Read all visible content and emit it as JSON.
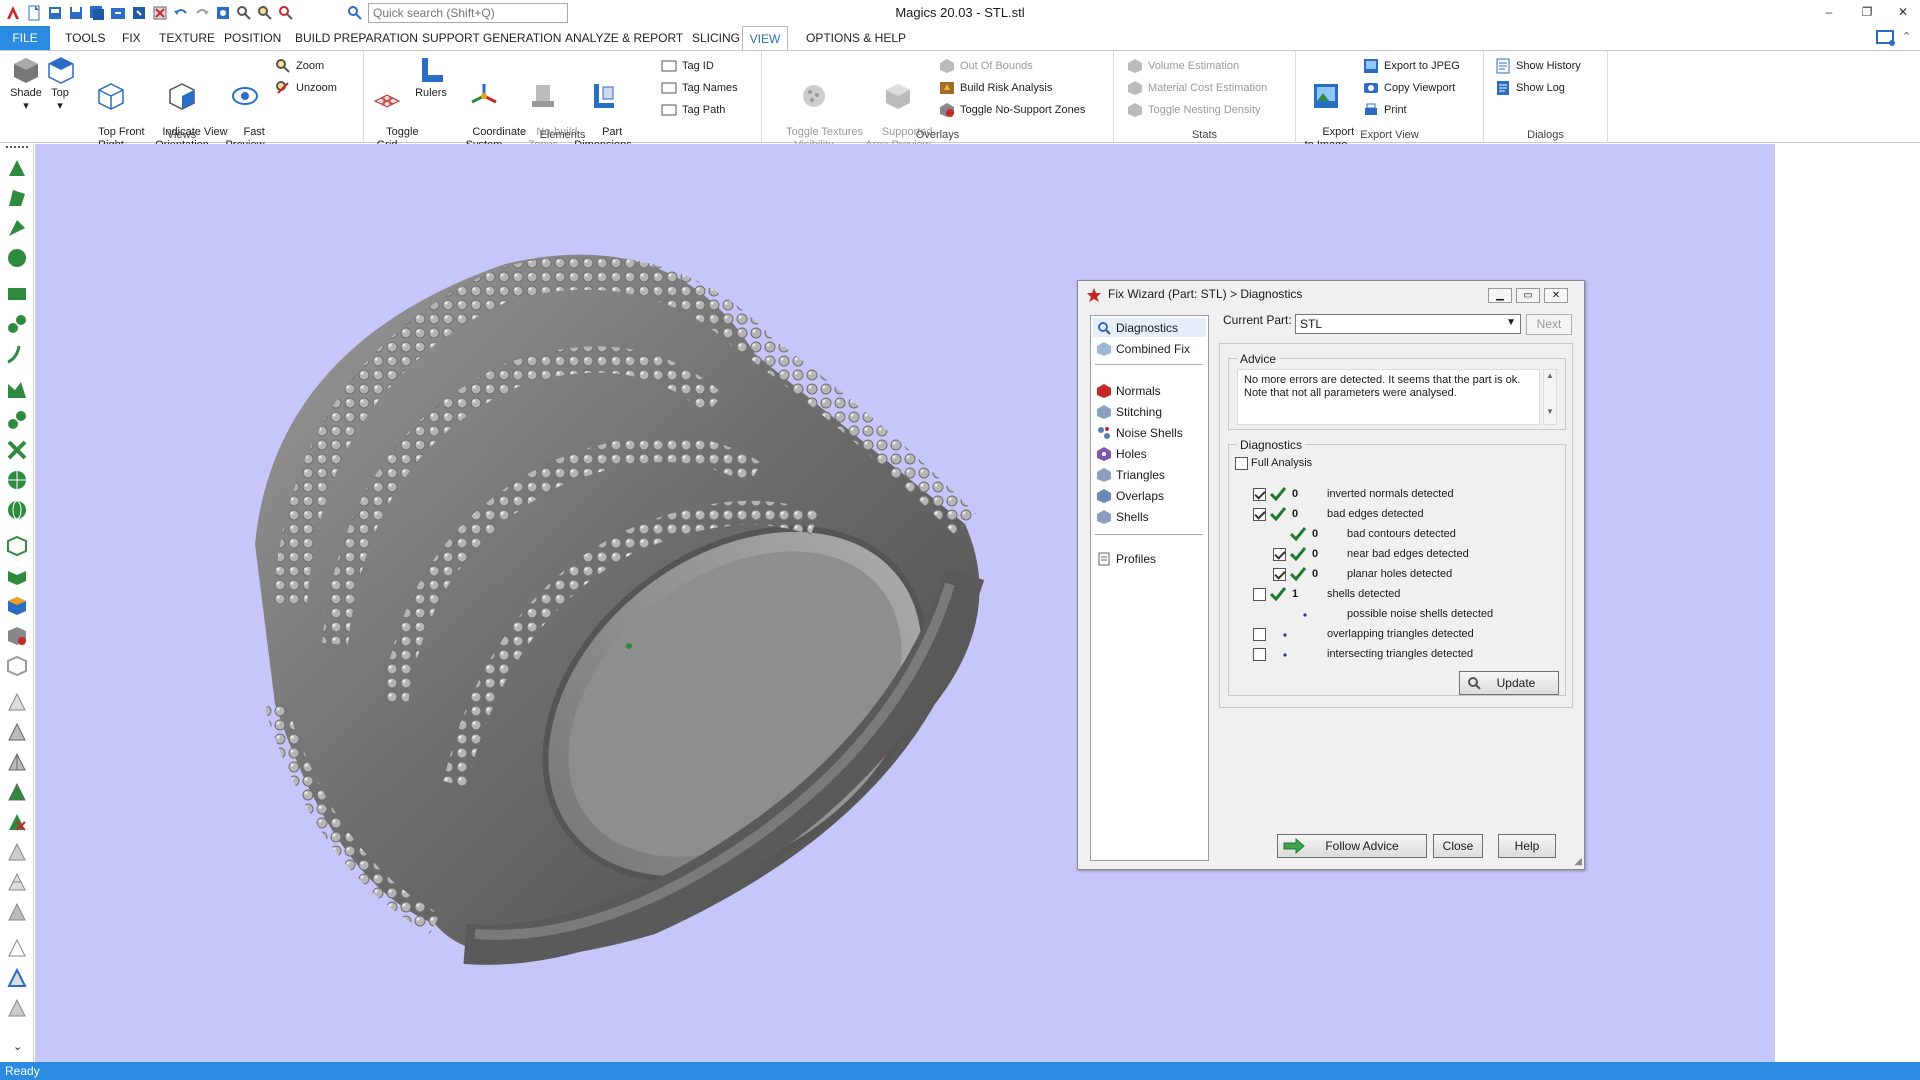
{
  "app": {
    "title": "Magics 20.03 - STL.stl"
  },
  "quick_search": {
    "placeholder": "Quick search (Shift+Q)"
  },
  "tabs": {
    "file": "FILE",
    "tools": "TOOLS",
    "fix": "FIX",
    "texture": "TEXTURE",
    "position": "POSITION",
    "build_preparation": "BUILD PREPARATION",
    "support_generation": "SUPPORT GENERATION",
    "analyze_report": "ANALYZE & REPORT",
    "slicing": "SLICING",
    "view": "VIEW",
    "options_help": "OPTIONS & HELP"
  },
  "ribbon": {
    "views": {
      "label": "Views",
      "shade": "Shade",
      "top": "Top",
      "top_front_right": "Top Front\nRight",
      "indicate_view_orientation": "Indicate View\nOrientation",
      "fast_preview": "Fast\nPreview",
      "zoom": "Zoom",
      "unzoom": "Unzoom"
    },
    "elements": {
      "label": "Elements",
      "toggle_grid": "Toggle\nGrid",
      "rulers": "Rulers",
      "coordinate_system": "Coordinate\nSystem",
      "no_build_zones": "No-build\nZones",
      "part_dimensions": "Part\nDimensions",
      "tag_id": "Tag ID",
      "tag_names": "Tag Names",
      "tag_path": "Tag Path"
    },
    "overlays": {
      "label": "Overlays",
      "toggle_textures_visibility": "Toggle Textures\nVisibility",
      "supported_area_preview": "Supported\nArea Preview",
      "out_of_bounds": "Out Of Bounds",
      "build_risk_analysis": "Build Risk Analysis",
      "toggle_no_support_zones": "Toggle No-Support Zones"
    },
    "stats": {
      "label": "Stats",
      "volume_estimation": "Volume Estimation",
      "material_cost_estimation": "Material Cost Estimation",
      "toggle_nesting_density": "Toggle Nesting Density"
    },
    "export_view": {
      "label": "Export View",
      "export_to_image": "Export\nto Image",
      "export_to_jpeg": "Export to JPEG",
      "copy_viewport": "Copy Viewport",
      "print": "Print"
    },
    "dialogs": {
      "label": "Dialogs",
      "show_history": "Show History",
      "show_log": "Show Log"
    }
  },
  "status": {
    "text": "Ready"
  },
  "dialog": {
    "title": "Fix Wizard (Part: STL) > Diagnostics",
    "nav": {
      "diagnostics": "Diagnostics",
      "combined_fix": "Combined Fix",
      "normals": "Normals",
      "stitching": "Stitching",
      "noise_shells": "Noise Shells",
      "holes": "Holes",
      "triangles": "Triangles",
      "overlaps": "Overlaps",
      "shells": "Shells",
      "profiles": "Profiles"
    },
    "current_part_label": "Current Part:",
    "current_part_value": "STL",
    "next": "Next",
    "advice_title": "Advice",
    "advice_text": "No more errors are detected. It seems that the part is ok. Note that not all parameters were analysed.",
    "diagnostics_title": "Diagnostics",
    "full_analysis": "Full Analysis",
    "rows": [
      {
        "checked": true,
        "status": "ok",
        "count": "0",
        "label": "inverted normals detected"
      },
      {
        "checked": true,
        "status": "ok",
        "count": "0",
        "label": "bad edges detected"
      },
      {
        "checked": null,
        "status": "ok",
        "count": "0",
        "label": "bad contours detected"
      },
      {
        "checked": true,
        "status": "ok",
        "count": "0",
        "label": "near bad edges detected"
      },
      {
        "checked": true,
        "status": "ok",
        "count": "0",
        "label": "planar holes detected"
      },
      {
        "checked": false,
        "status": "ok",
        "count": "1",
        "label": "shells detected"
      },
      {
        "checked": null,
        "status": "dot",
        "count": "",
        "label": "possible noise shells detected"
      },
      {
        "checked": false,
        "status": "dot",
        "count": "",
        "label": "overlapping triangles detected"
      },
      {
        "checked": false,
        "status": "dot",
        "count": "",
        "label": "intersecting triangles detected"
      }
    ],
    "update": "Update",
    "follow_advice": "Follow Advice",
    "close": "Close",
    "help": "Help"
  },
  "colors": {
    "accent": "#2b8be0",
    "viewport": "#c6c6fa",
    "check": "#1f7a2e"
  }
}
